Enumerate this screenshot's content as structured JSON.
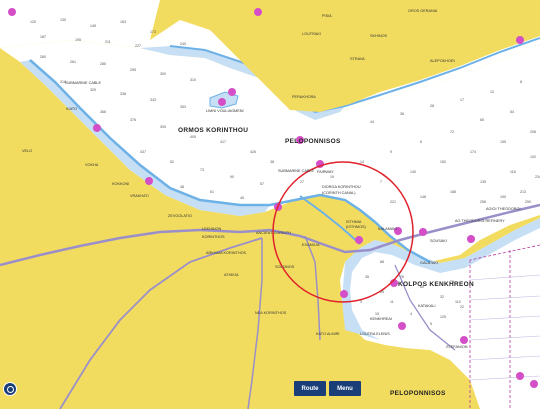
{
  "labels": {
    "ormos_korinthou": "ORMOS KORINTHOU",
    "peloponnisos_top": "PELOPONNISOS",
    "kolpos_kenkhreon": "KOLPOS KENKHREON",
    "peloponnisos_bottom": "PELOPONNISOS",
    "diorga_korinthou": "DIORGA KORINTHOU",
    "corinth_canal": "(CORINTH CANAL)",
    "isthmia": "ISTHMIA",
    "isthmia_sub": "(ISTHMOS)",
    "kato_almiri": "KATO ALMIRI",
    "loutraki": "LOUTRAKI",
    "perakhora": "PERAKHORA",
    "strava": "STRAVA",
    "kalamaki": "KALAMAKI",
    "ancient_corinth": "ANCIENT CORINTH",
    "korinthos": "KORINTHOS",
    "lekhaion": "LEKHAION",
    "kenkhreai": "KENKHREAI",
    "kato_almiri_village": "KATO ALMIRI",
    "kiato": "KIATO",
    "vokha": "VOKHA",
    "agioi_theodoroi": "AGIOI THEODOROI",
    "sousaki": "SOUSAKI",
    "vouliagmeni": "LIMNI VOULIAGMENI",
    "submarine_cable": "SUBMARINE CABLE",
    "fairway": "FAIRWAY",
    "submarine_cable_2": "SUBMARINE CABLE",
    "pelopia": "PELOPIA",
    "examilia": "EXAMILIA",
    "xylokastro_road": "ZEVGOLATEIO",
    "anc_korinthos": "ARKHAIA KORINTHOS",
    "posidonia": "POSIDONIA",
    "nera_korinthou": "NEA KORINTHOS",
    "solomos": "SOLOMOS",
    "athikia": "ATHIKIA",
    "kenkhreai_sub": "KENKHREAI",
    "loutra_elenis": "LOUTRA ELENIS",
    "kato_atheni": "KATO ATHENI",
    "pefkakia": "PEFKAKIA",
    "katakali": "KATAKALI",
    "stefanion": "STEFANION",
    "galataki": "GALATAKI",
    "mertidi": "MERTIDI",
    "nera_mygdalia": "NERA MYGDALIA",
    "kiato_l": "KATO",
    "stimanga": "STIMANGA",
    "velo": "VELO",
    "bolatio": "BOLATI",
    "zevgolatio": "ZEVGOLATIO",
    "vrakhati": "VRAKHATI",
    "kokkoni": "KOKKONI",
    "nerantza": "NERANTZA",
    "megara_road": "AKHAIKON",
    "ag_ioannis": "AGIOS IOANNIS",
    "pisia": "PISIA",
    "schinos": "SKHINOS",
    "panagitsa": "PANAGITSA",
    "alepochori": "ALEPOKHORI",
    "ag_theodori_ref": "AG THEODOROI REFINERY",
    "isthmos_port": "ISTHMOS PORT",
    "kehries": "KEKHRIES",
    "oros_gerania": "OROS GERANIA"
  },
  "depths": [
    "120",
    "130",
    "145",
    "163",
    "173",
    "187",
    "195",
    "211",
    "227",
    "240",
    "260",
    "261",
    "285",
    "295",
    "300",
    "310",
    "318",
    "329",
    "338",
    "343",
    "353",
    "368",
    "376",
    "393",
    "405",
    "417",
    "426",
    "437",
    "52",
    "73",
    "90",
    "57",
    "48",
    "61",
    "45",
    "38",
    "27",
    "19",
    "14",
    "9",
    "6",
    "72",
    "65",
    "54",
    "44",
    "36",
    "28",
    "17",
    "12",
    "8",
    "7",
    "140",
    "152",
    "174",
    "155",
    "208",
    "221",
    "146",
    "168",
    "135",
    "116",
    "102",
    "88",
    "76",
    "60",
    "32",
    "22",
    "11",
    "4",
    "5",
    "3",
    "15",
    "25",
    "35",
    "70",
    "110",
    "125",
    "190",
    "213",
    "234",
    "258",
    "250"
  ],
  "controls": {
    "route_label": "Route",
    "menu_label": "Menu"
  },
  "colors": {
    "land": "#f2dc5f",
    "water_deep": "#ffffff",
    "water_shallow": "#c6dff5",
    "coast_shallow": "#8ec5ee",
    "road": "#9a8fc9",
    "canal_circle": "#e0212b",
    "marina_marker": "#d44fc7",
    "button": "#1a3f78",
    "shipping_lane": "#b23ca3"
  },
  "icons": [
    "marina-marker-icon",
    "compass-icon",
    "info-icon"
  ]
}
